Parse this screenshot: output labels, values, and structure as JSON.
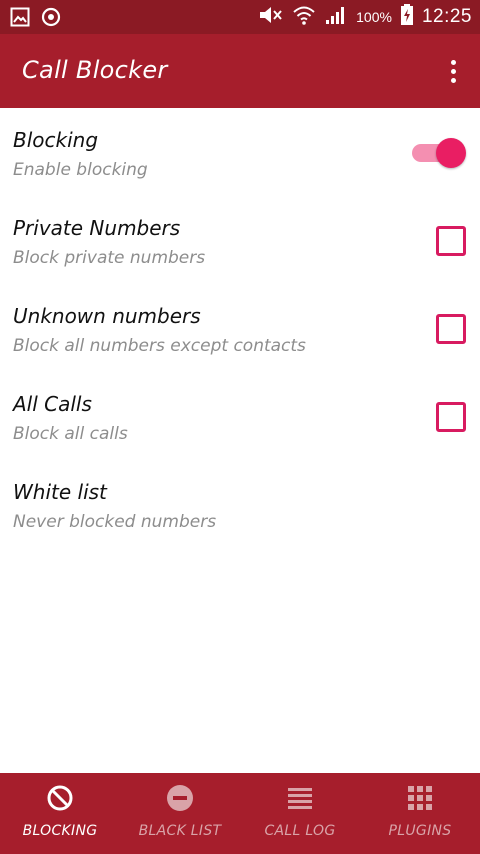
{
  "status_bar": {
    "battery_percent": "100%",
    "time": "12:25",
    "icons": [
      "gallery-icon",
      "sync-icon",
      "mute-icon",
      "wifi-icon",
      "signal-icon",
      "battery-charging-icon"
    ]
  },
  "app_bar": {
    "title": "Call Blocker",
    "menu_icon": "overflow-menu-icon"
  },
  "settings": {
    "blocking": {
      "title": "Blocking",
      "subtitle": "Enable blocking",
      "enabled": true
    },
    "private_numbers": {
      "title": "Private Numbers",
      "subtitle": "Block private numbers",
      "checked": false
    },
    "unknown_numbers": {
      "title": "Unknown numbers",
      "subtitle": "Block all numbers except contacts",
      "checked": false
    },
    "all_calls": {
      "title": "All Calls",
      "subtitle": "Block all calls",
      "checked": false
    },
    "white_list": {
      "title": "White list",
      "subtitle": "Never blocked numbers"
    }
  },
  "bottom_nav": {
    "items": [
      {
        "label": "BLOCKING",
        "icon": "block-icon",
        "active": true
      },
      {
        "label": "BLACK LIST",
        "icon": "minus-circle-icon",
        "active": false
      },
      {
        "label": "CALL LOG",
        "icon": "list-icon",
        "active": false
      },
      {
        "label": "PLUGINS",
        "icon": "grid-icon",
        "active": false
      }
    ]
  },
  "colors": {
    "status_bar": "#8b1a24",
    "primary": "#a61e2c",
    "accent": "#e91e63",
    "accent_light": "#f48fb1",
    "subtitle": "#8d8d8d",
    "nav_inactive": "#d9a3a8"
  }
}
